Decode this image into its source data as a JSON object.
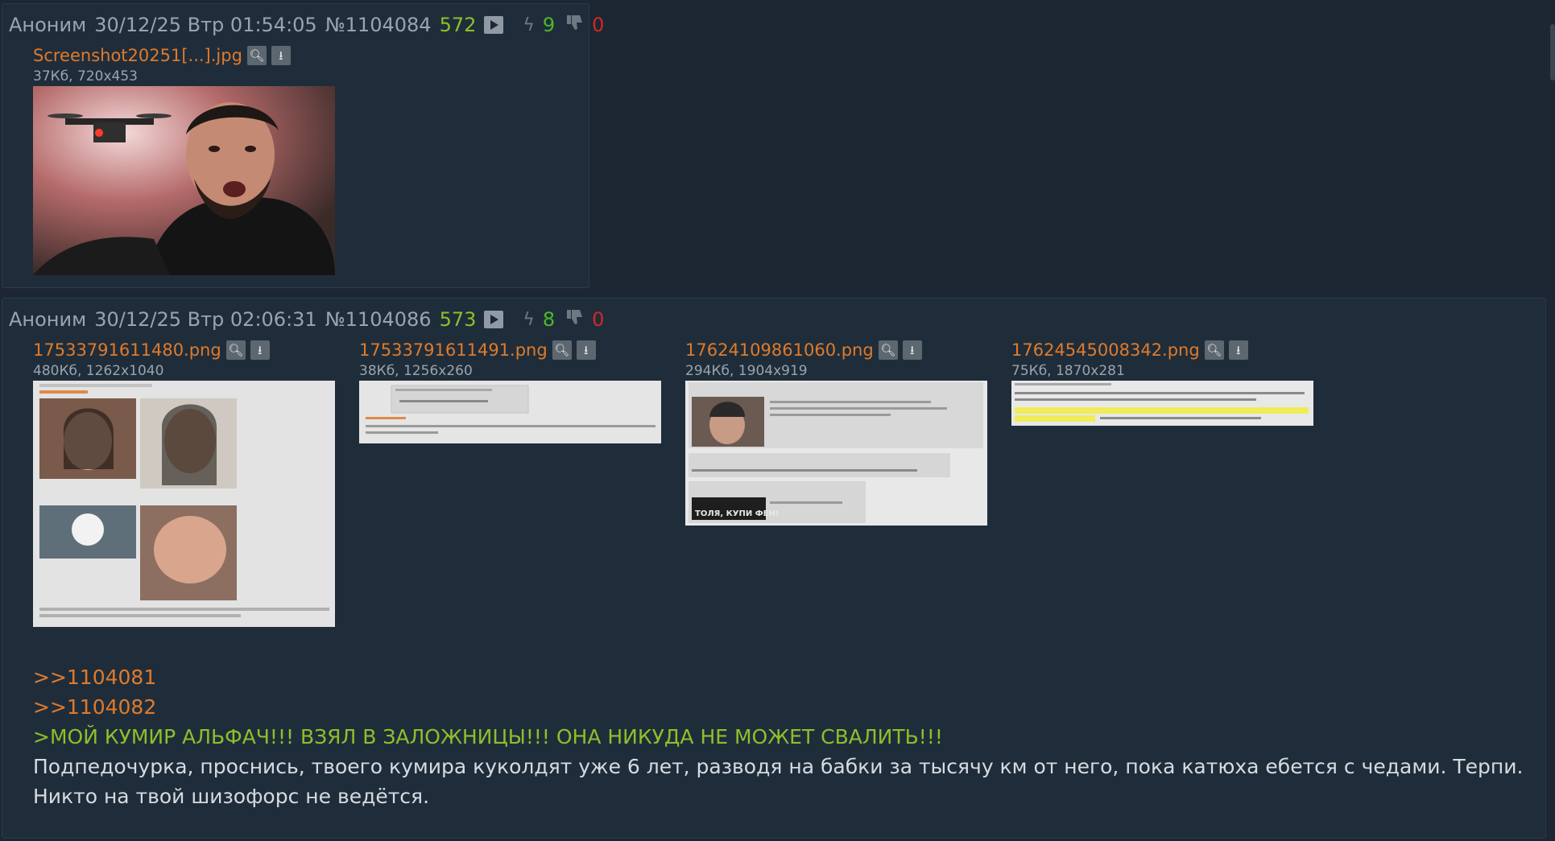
{
  "posts": [
    {
      "author": "Аноним",
      "date": "30/12/25 Втр 01:54:05",
      "number": "№1104084",
      "ordinal": "572",
      "likes": "9",
      "dislikes": "0",
      "files": [
        {
          "name": "Screenshot20251[...].jpg",
          "meta": "37Кб, 720x453"
        }
      ]
    },
    {
      "author": "Аноним",
      "date": "30/12/25 Втр 02:06:31",
      "number": "№1104086",
      "ordinal": "573",
      "likes": "8",
      "dislikes": "0",
      "files": [
        {
          "name": "17533791611480.png",
          "meta": "480Кб, 1262x1040"
        },
        {
          "name": "17533791611491.png",
          "meta": "38Кб, 1256x260"
        },
        {
          "name": "17624109861060.png",
          "meta": "294Кб, 1904x919"
        },
        {
          "name": "17624545008342.png",
          "meta": "75Кб, 1870x281"
        }
      ],
      "comment": {
        "reply1": ">>1104081",
        "reply2": ">>1104082",
        "greentext": ">МОЙ КУМИР АЛЬФАЧ!!! ВЗЯЛ В ЗАЛОЖНИЦЫ!!! ОНА НИКУДА НЕ МОЖЕТ СВАЛИТЬ!!!",
        "line1": "Подпедочурка, проснись, твоего кумира куколдят уже 6 лет, разводя на бабки за тысячу км от него, пока катюха ебется с чедами. Терпи.",
        "line2": "Никто на твой шизофорс не ведётся."
      }
    }
  ],
  "icons": {
    "play": "play-icon",
    "bolt": "bolt-icon",
    "dislike": "thumbs-down-icon",
    "search": "magnifier-icon",
    "download": "download-icon"
  },
  "colors": {
    "background": "#1c2733",
    "post_bg": "#1f2d3b",
    "link": "#e07a2a",
    "greentext": "#8fbf2a",
    "like": "#4cb82a",
    "dislike": "#d32727"
  }
}
